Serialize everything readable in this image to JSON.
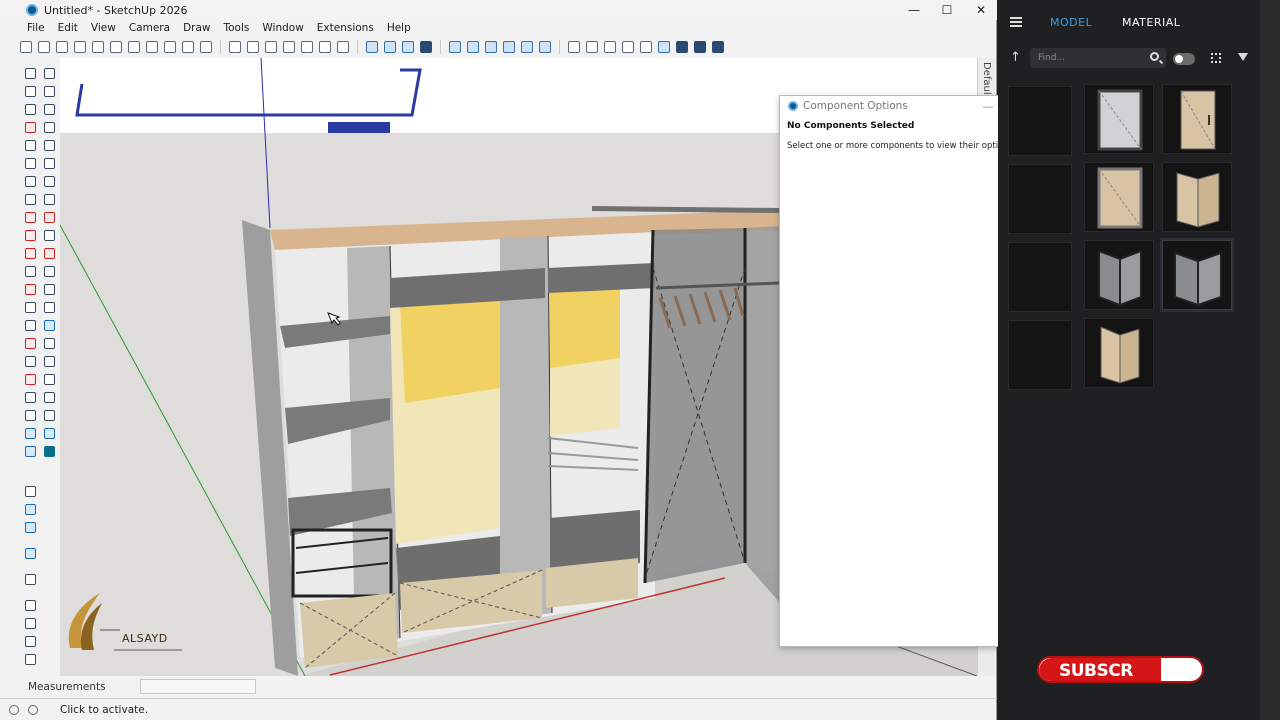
{
  "window": {
    "title": "Untitled* - SketchUp 2026",
    "minimize": "—",
    "maximize": "☐",
    "close": "✕"
  },
  "menu": [
    "File",
    "Edit",
    "View",
    "Camera",
    "Draw",
    "Tools",
    "Window",
    "Extensions",
    "Help"
  ],
  "tray_tab": "Default Tray",
  "watermark": {
    "text": "ALSAYD"
  },
  "measurements": {
    "label": "Measurements"
  },
  "status": {
    "text": "Click to activate."
  },
  "component_options": {
    "title": "Component Options",
    "heading": "No Components Selected",
    "message": "Select one or more components to view their options."
  },
  "side_panel": {
    "tabs": {
      "model": "MODEL",
      "material": "MATERIAL"
    },
    "search": {
      "placeholder": "Find..."
    },
    "up_icon": "↑"
  },
  "subscribe": {
    "text": "SUBSCR"
  },
  "colors": {
    "accent_blue": "#3aa0e8",
    "panel_bg": "#1f2022",
    "subscribe_red": "#d41616"
  }
}
